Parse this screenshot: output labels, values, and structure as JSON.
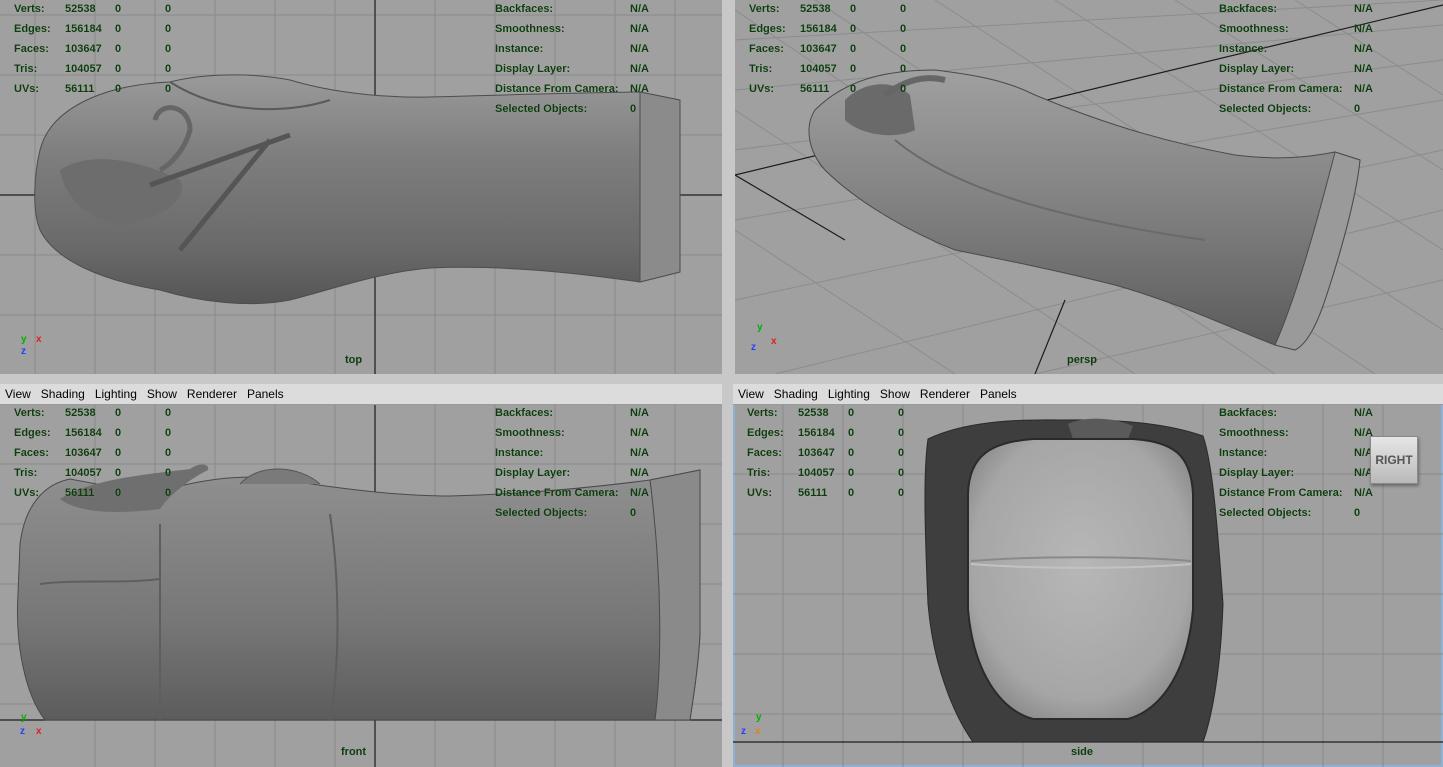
{
  "menu": [
    "View",
    "Shading",
    "Lighting",
    "Show",
    "Renderer",
    "Panels"
  ],
  "stats": [
    {
      "label": "Verts:",
      "v1": "52538",
      "v2": "0",
      "v3": "0"
    },
    {
      "label": "Edges:",
      "v1": "156184",
      "v2": "0",
      "v3": "0"
    },
    {
      "label": "Faces:",
      "v1": "103647",
      "v2": "0",
      "v3": "0"
    },
    {
      "label": "Tris:",
      "v1": "104057",
      "v2": "0",
      "v3": "0"
    },
    {
      "label": "UVs:",
      "v1": "56111",
      "v2": "0",
      "v3": "0"
    }
  ],
  "details": [
    {
      "label": "Backfaces:",
      "value": "N/A"
    },
    {
      "label": "Smoothness:",
      "value": "N/A"
    },
    {
      "label": "Instance:",
      "value": "N/A"
    },
    {
      "label": "Display Layer:",
      "value": "N/A"
    },
    {
      "label": "Distance From Camera:",
      "value": "N/A"
    },
    {
      "label": "Selected Objects:",
      "value": "0"
    }
  ],
  "viewports": {
    "top": {
      "camera": "top"
    },
    "persp": {
      "camera": "persp"
    },
    "front": {
      "camera": "front"
    },
    "side": {
      "camera": "side"
    }
  },
  "viewcube_label": "RIGHT",
  "axis_labels": {
    "x": "x",
    "y": "y",
    "z": "z"
  },
  "colors": {
    "viewport_bg": "#a0a0a0",
    "hud_text": "#0d3d0d",
    "active_border": "#8fb1d6",
    "model_gray": "#7b7b7b"
  }
}
